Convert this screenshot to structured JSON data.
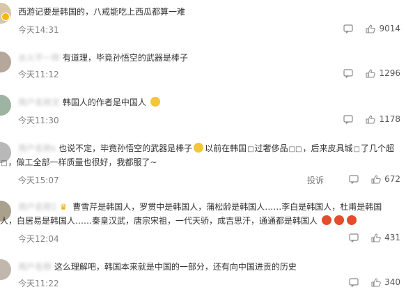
{
  "comments": [
    {
      "user": "",
      "text": "西游记要是韩国的，八戒能吃上西瓜都算一难",
      "time": "今天14:31",
      "likes": "9014"
    },
    {
      "user": "",
      "text": "有道理，毕竟孙悟空的武器是棒子",
      "time": "今天11:12",
      "likes": "1296"
    },
    {
      "user": "",
      "text": "韩国人的作者是中国人",
      "time": "今天11:30",
      "likes": "1178"
    },
    {
      "user": "",
      "text_line1": "也说不定，毕竟孙悟空的武器是棒子",
      "text_line1b": "以前在韩国",
      "text_line1c": "过奢侈品",
      "text_line1d": "，后来皮具城",
      "text_line1e": "了几个超",
      "text_line2": "，做工全部一样质量也很好，我都服了~",
      "time": "今天15:07",
      "report_label": "投诉",
      "likes": "672"
    },
    {
      "user": "",
      "text_line1": "曹雪芹是韩国人，罗贯中是韩国人，蒲松龄是韩国人……李白是韩国人，杜甫是韩国",
      "text_line2": "人，白居易是韩国人……秦皇汉武，唐宗宋祖，一代天骄，成吉思汗，通通都是韩国人",
      "time": "今天12:04",
      "likes": "431"
    },
    {
      "user": "",
      "text": "这么理解吧，韩国本来就是中国的一部分，还有向中国进贡的历史",
      "time": "今天11:22",
      "likes": "340"
    }
  ],
  "icons": {
    "comment": "comment-icon",
    "like": "thumbs-up-icon",
    "emoji": "smile-emoji-icon",
    "crown": "crown-icon"
  },
  "colors": {
    "text": "#333333",
    "time": "#808080",
    "count": "#555555"
  }
}
